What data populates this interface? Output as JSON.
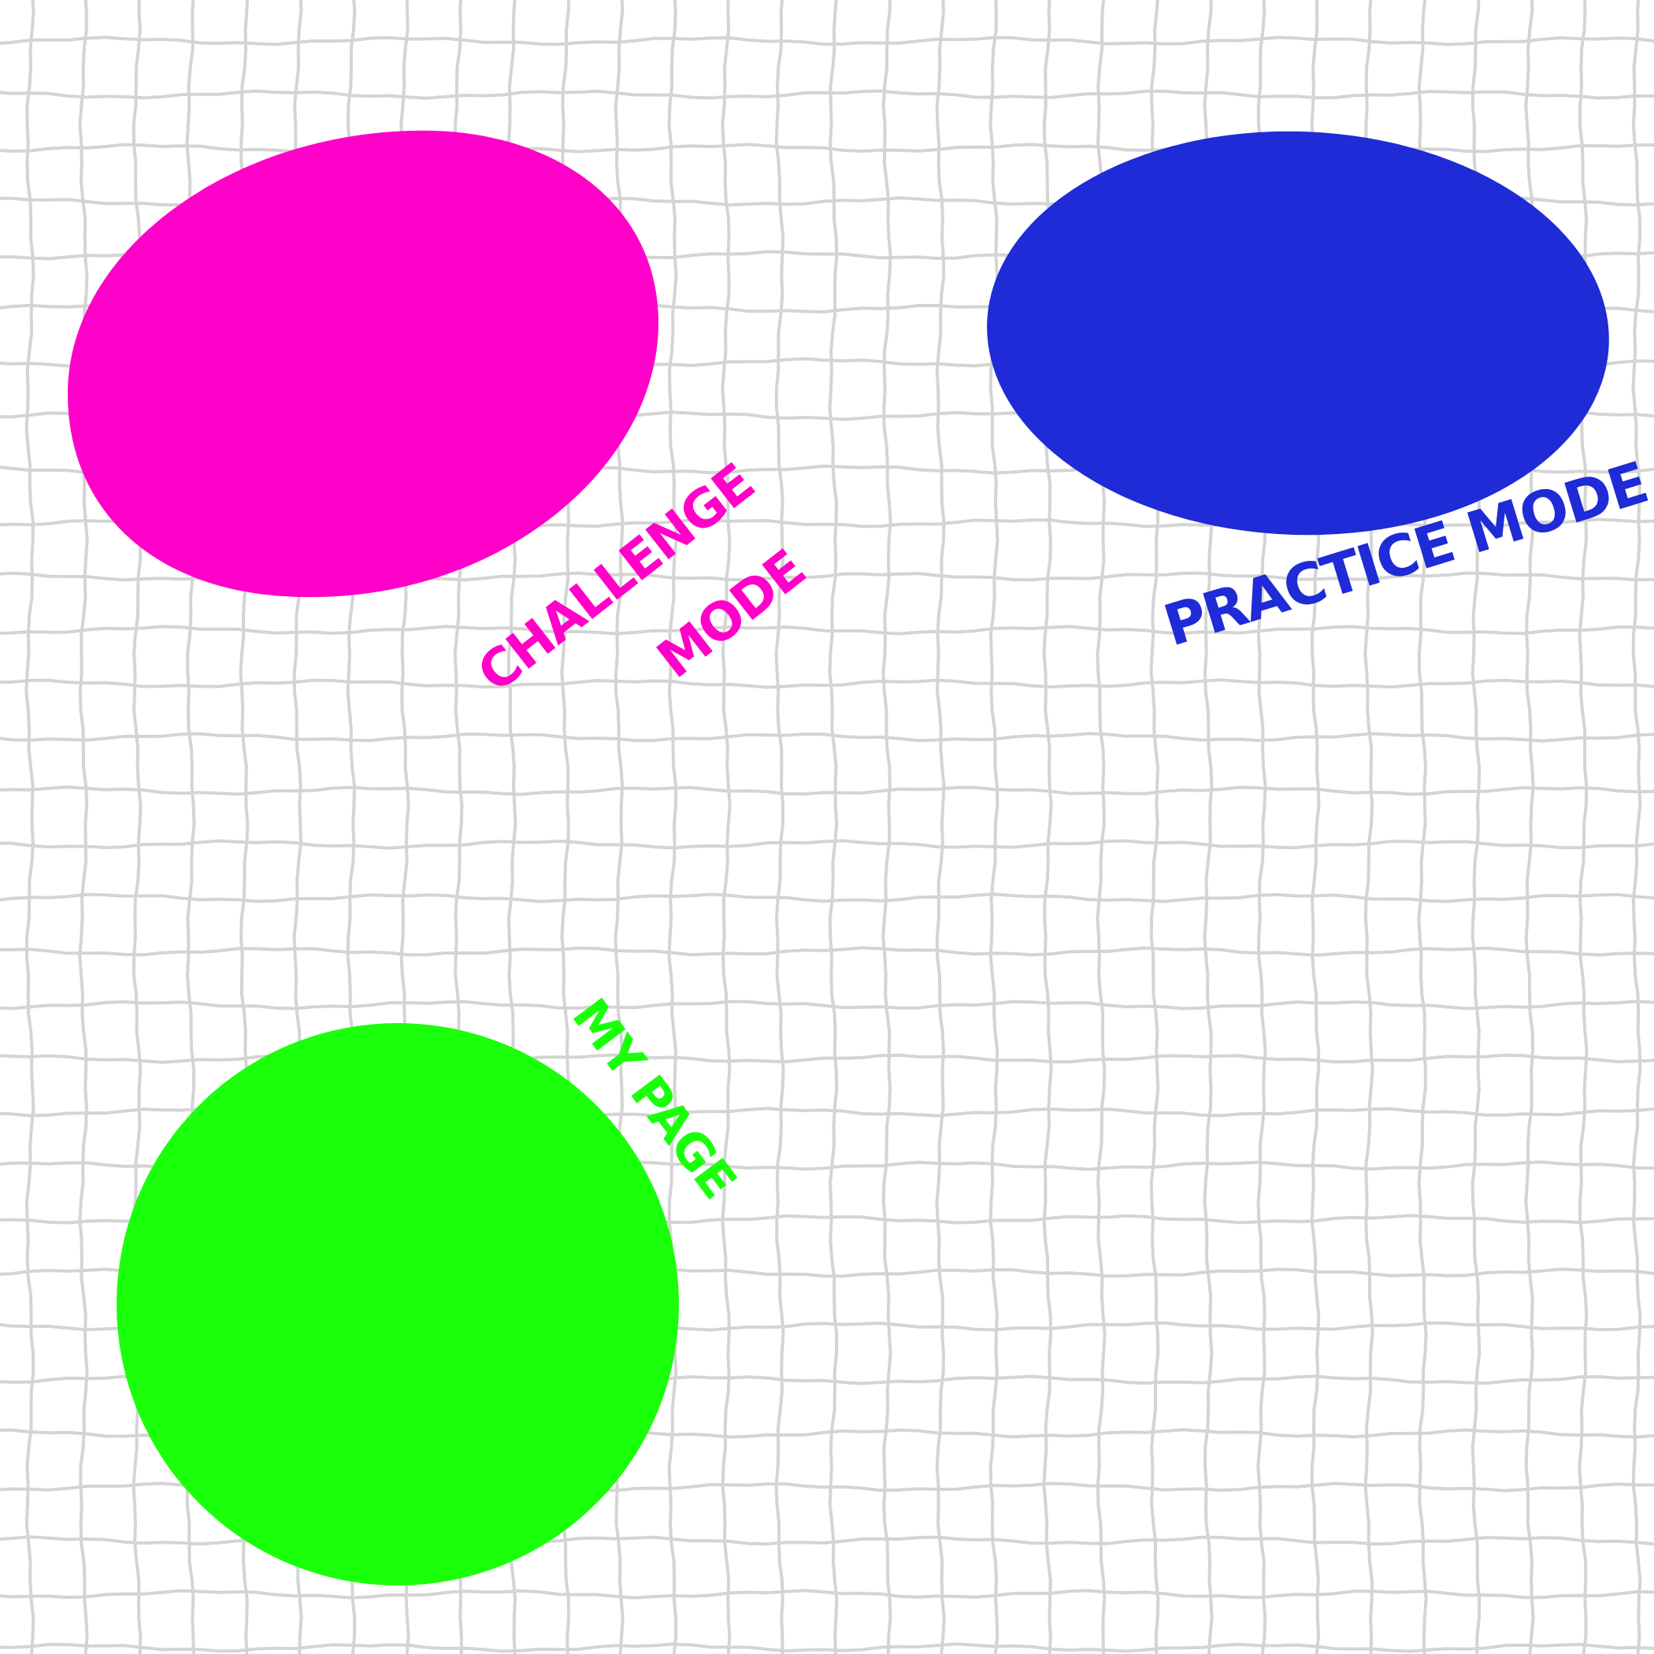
{
  "buttons": {
    "challenge": {
      "label_line1": "CHALLENGE",
      "label_line2": "MODE",
      "color": "#ff00c8"
    },
    "practice": {
      "label": "PRACTICE MODE",
      "color": "#1e2bd6"
    },
    "my_page": {
      "label": "MY PAGE",
      "color": "#1aff0a"
    }
  },
  "background": {
    "color": "#ffffff",
    "grid_color": "#d4d4d4"
  }
}
